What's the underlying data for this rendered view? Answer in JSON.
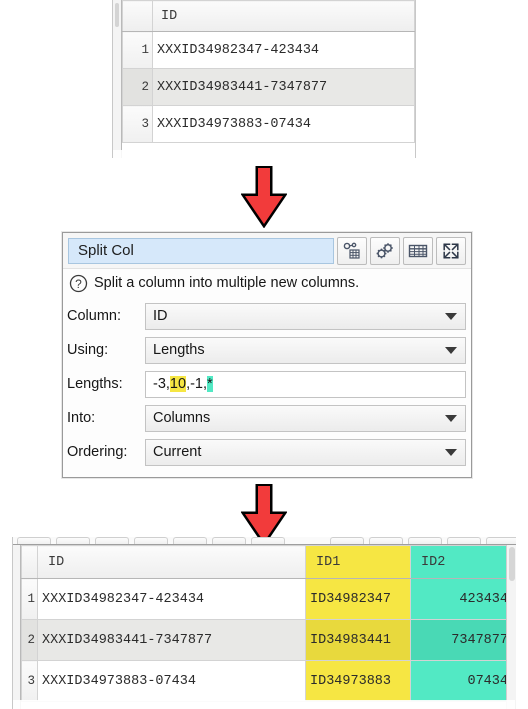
{
  "top_table": {
    "name": "source-data-grid",
    "columns": [
      "ID"
    ],
    "rows": [
      {
        "num": "1",
        "id": "XXXID34982347-423434"
      },
      {
        "num": "2",
        "id": "XXXID34983441-7347877"
      },
      {
        "num": "3",
        "id": "XXXID34973883-07434"
      }
    ]
  },
  "arrows": {
    "top_icon": "down-arrow-icon",
    "bottom_icon": "down-arrow-icon",
    "color": "#F23B3B"
  },
  "dialog": {
    "title": "Split Col",
    "description": "Split a column into multiple new columns.",
    "help_icon": "question-mark-icon",
    "toolbar": [
      {
        "name": "dependencies-icon",
        "label": ""
      },
      {
        "name": "gears-icon",
        "label": ""
      },
      {
        "name": "table-icon",
        "label": ""
      },
      {
        "name": "expand-icon",
        "label": ""
      }
    ],
    "fields": [
      {
        "label": "Column:",
        "value": "ID",
        "type": "combo"
      },
      {
        "label": "Using:",
        "value": "Lengths",
        "type": "combo"
      },
      {
        "label": "Lengths:",
        "value": "-3,10,-1,*",
        "type": "text"
      },
      {
        "label": "Into:",
        "value": "Columns",
        "type": "combo"
      },
      {
        "label": "Ordering:",
        "value": "Current",
        "type": "combo"
      }
    ],
    "lengths_parts": [
      {
        "text": "-3,",
        "highlight": "none"
      },
      {
        "text": "10",
        "highlight": "yellow"
      },
      {
        "text": ",-1,",
        "highlight": "none"
      },
      {
        "text": "*",
        "highlight": "cyan"
      }
    ]
  },
  "bottom_table": {
    "name": "result-data-grid",
    "columns": [
      {
        "label": "ID",
        "color": "none"
      },
      {
        "label": "ID1",
        "color": "yellow"
      },
      {
        "label": "ID2",
        "color": "cyan"
      }
    ],
    "rows": [
      {
        "num": "1",
        "id": "XXXID34982347-423434",
        "id1": "ID34982347",
        "id2": "423434"
      },
      {
        "num": "2",
        "id": "XXXID34983441-7347877",
        "id1": "ID34983441",
        "id2": "7347877"
      },
      {
        "num": "3",
        "id": "XXXID34973883-07434",
        "id1": "ID34973883",
        "id2": "07434"
      }
    ]
  },
  "colors": {
    "yellow": "#F6E643",
    "cyan": "#52E9C4",
    "arrow_red": "#F23B3B",
    "title_field_blue": "#D6E8FA"
  }
}
